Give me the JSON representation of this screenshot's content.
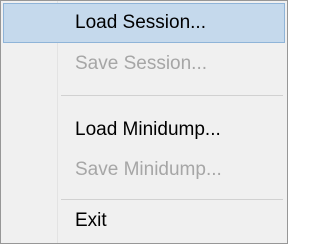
{
  "menu": {
    "items": [
      {
        "label": "Load Session...",
        "enabled": true,
        "highlighted": true
      },
      {
        "label": "Save Session...",
        "enabled": false,
        "highlighted": false
      },
      {
        "label": "Load Minidump...",
        "enabled": true,
        "highlighted": false
      },
      {
        "label": "Save Minidump...",
        "enabled": false,
        "highlighted": false
      },
      {
        "label": "Exit",
        "enabled": true,
        "highlighted": false
      }
    ]
  },
  "colors": {
    "highlight_fill": "#c5d9ec",
    "highlight_border": "#8fb4d8",
    "menu_background": "#f0f0f0",
    "disabled_text": "#a6a6a6"
  }
}
